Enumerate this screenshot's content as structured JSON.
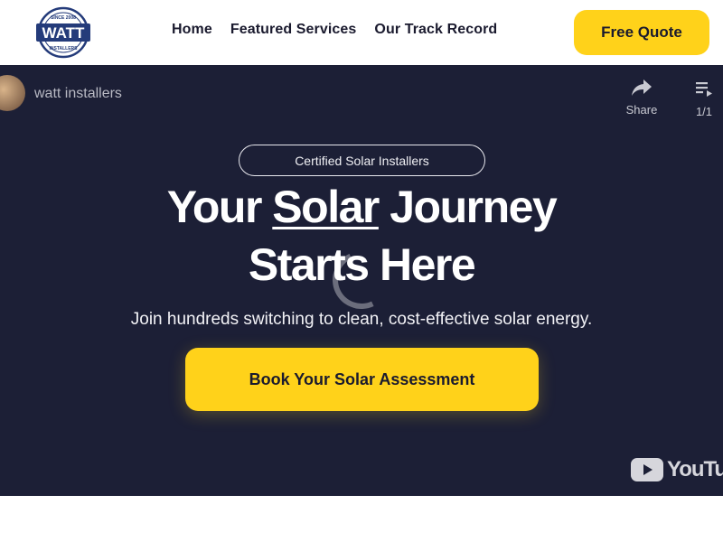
{
  "header": {
    "logo": {
      "top_text": "SINCE 2008",
      "main_text": "WATT",
      "bottom_text": "INSTALLERS"
    },
    "nav": [
      {
        "label": "Home"
      },
      {
        "label": "Featured Services"
      },
      {
        "label": "Our Track Record"
      }
    ],
    "quote_button": "Free Quote"
  },
  "video": {
    "channel_name": "watt installers",
    "share_label": "Share",
    "playlist_count": "1/1",
    "youtube_label": "YouTube",
    "share_icon": "share-arrow-icon",
    "playlist_icon": "playlist-icon"
  },
  "hero": {
    "badge": "Certified Solar Installers",
    "headline_part1": "Your ",
    "headline_highlight": "Solar",
    "headline_part2": " Journey",
    "headline_line2": "Starts Here",
    "subtitle": "Join hundreds switching to clean, cost-effective solar energy.",
    "cta": "Book Your Solar Assessment"
  },
  "colors": {
    "accent": "#ffd21a",
    "hero_background": "#1c1f36",
    "logo_blue": "#243b7a",
    "text_dark": "#1a1a2e"
  }
}
